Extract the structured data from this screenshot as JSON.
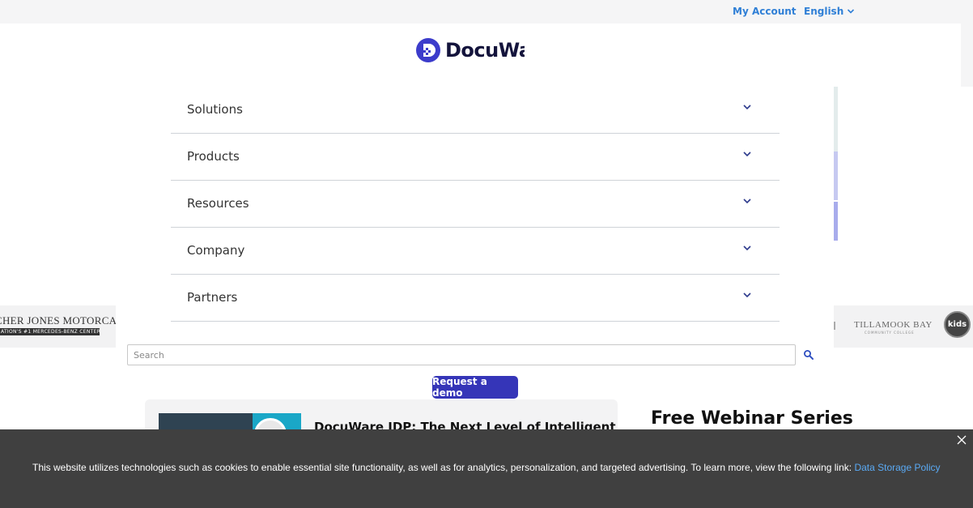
{
  "topbar": {
    "account_label": "My Account",
    "language_label": "English"
  },
  "logo": {
    "text": "DocuWare"
  },
  "nav": {
    "items": [
      {
        "label": "Solutions"
      },
      {
        "label": "Products"
      },
      {
        "label": "Resources"
      },
      {
        "label": "Company"
      },
      {
        "label": "Partners"
      }
    ]
  },
  "logos": {
    "left_line1": "CHER JONES MOTORCARS",
    "left_line2": "ATION'S #1 MERCEDES-BENZ CENTER",
    "right_name": "TILLAMOOK BAY",
    "right_sub": "COMMUNITY COLLEGE",
    "kids": "kids"
  },
  "search": {
    "placeholder": "Search"
  },
  "demo_button": "Request a demo",
  "card": {
    "title": "DocuWare IDP: The Next Level of Intelligent"
  },
  "webinar_heading": "Free Webinar Series",
  "cookie": {
    "text": "This website utilizes technologies such as cookies to enable essential site functionality, as well as for analytics, personalization, and targeted advertising. To learn more, view the following link: ",
    "policy_link": "Data Storage Policy"
  },
  "colors": {
    "accent": "#3535b8",
    "link": "#2f7fd6",
    "cookie_bg": "#404040"
  }
}
